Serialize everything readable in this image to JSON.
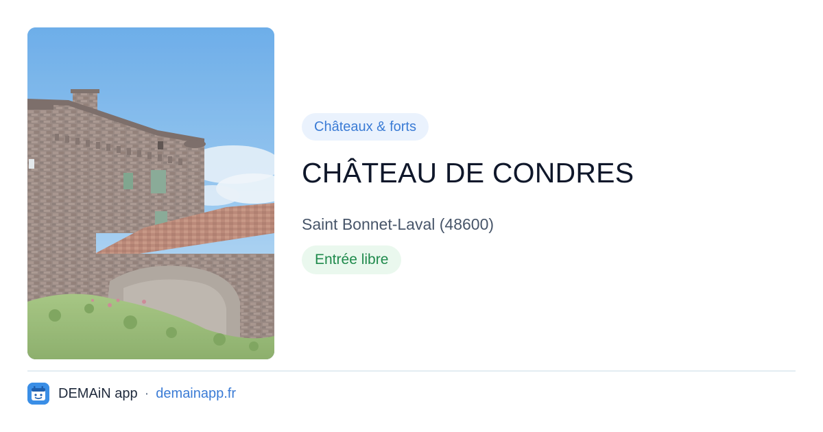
{
  "card": {
    "category": "Châteaux & forts",
    "title": "CHÂTEAU DE CONDRES",
    "location": "Saint Bonnet-Laval (48600)",
    "status": "Entrée libre"
  },
  "footer": {
    "app_name": "DEMAiN app",
    "separator": "·",
    "link": "demainapp.fr",
    "app_icon": "demain-app-icon"
  },
  "colors": {
    "category_text": "#3a7bd5",
    "category_bg": "#eaf2fd",
    "status_text": "#1f8a4c",
    "status_bg": "#eaf8ee",
    "title_text": "#0f172a",
    "link_text": "#3a7bd5"
  }
}
